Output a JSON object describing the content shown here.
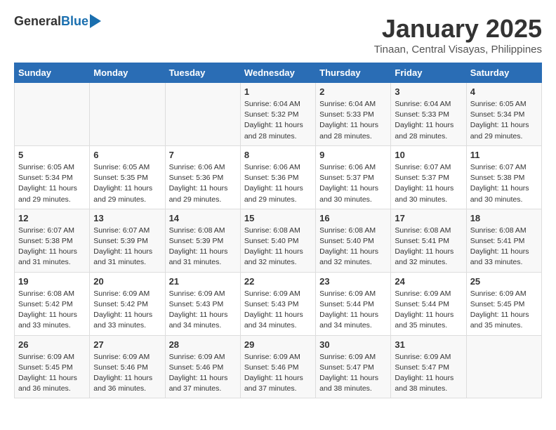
{
  "header": {
    "logo_general": "General",
    "logo_blue": "Blue",
    "month_title": "January 2025",
    "location": "Tinaan, Central Visayas, Philippines"
  },
  "days_of_week": [
    "Sunday",
    "Monday",
    "Tuesday",
    "Wednesday",
    "Thursday",
    "Friday",
    "Saturday"
  ],
  "weeks": [
    [
      {
        "day": "",
        "info": ""
      },
      {
        "day": "",
        "info": ""
      },
      {
        "day": "",
        "info": ""
      },
      {
        "day": "1",
        "info": "Sunrise: 6:04 AM\nSunset: 5:32 PM\nDaylight: 11 hours\nand 28 minutes."
      },
      {
        "day": "2",
        "info": "Sunrise: 6:04 AM\nSunset: 5:33 PM\nDaylight: 11 hours\nand 28 minutes."
      },
      {
        "day": "3",
        "info": "Sunrise: 6:04 AM\nSunset: 5:33 PM\nDaylight: 11 hours\nand 28 minutes."
      },
      {
        "day": "4",
        "info": "Sunrise: 6:05 AM\nSunset: 5:34 PM\nDaylight: 11 hours\nand 29 minutes."
      }
    ],
    [
      {
        "day": "5",
        "info": "Sunrise: 6:05 AM\nSunset: 5:34 PM\nDaylight: 11 hours\nand 29 minutes."
      },
      {
        "day": "6",
        "info": "Sunrise: 6:05 AM\nSunset: 5:35 PM\nDaylight: 11 hours\nand 29 minutes."
      },
      {
        "day": "7",
        "info": "Sunrise: 6:06 AM\nSunset: 5:36 PM\nDaylight: 11 hours\nand 29 minutes."
      },
      {
        "day": "8",
        "info": "Sunrise: 6:06 AM\nSunset: 5:36 PM\nDaylight: 11 hours\nand 29 minutes."
      },
      {
        "day": "9",
        "info": "Sunrise: 6:06 AM\nSunset: 5:37 PM\nDaylight: 11 hours\nand 30 minutes."
      },
      {
        "day": "10",
        "info": "Sunrise: 6:07 AM\nSunset: 5:37 PM\nDaylight: 11 hours\nand 30 minutes."
      },
      {
        "day": "11",
        "info": "Sunrise: 6:07 AM\nSunset: 5:38 PM\nDaylight: 11 hours\nand 30 minutes."
      }
    ],
    [
      {
        "day": "12",
        "info": "Sunrise: 6:07 AM\nSunset: 5:38 PM\nDaylight: 11 hours\nand 31 minutes."
      },
      {
        "day": "13",
        "info": "Sunrise: 6:07 AM\nSunset: 5:39 PM\nDaylight: 11 hours\nand 31 minutes."
      },
      {
        "day": "14",
        "info": "Sunrise: 6:08 AM\nSunset: 5:39 PM\nDaylight: 11 hours\nand 31 minutes."
      },
      {
        "day": "15",
        "info": "Sunrise: 6:08 AM\nSunset: 5:40 PM\nDaylight: 11 hours\nand 32 minutes."
      },
      {
        "day": "16",
        "info": "Sunrise: 6:08 AM\nSunset: 5:40 PM\nDaylight: 11 hours\nand 32 minutes."
      },
      {
        "day": "17",
        "info": "Sunrise: 6:08 AM\nSunset: 5:41 PM\nDaylight: 11 hours\nand 32 minutes."
      },
      {
        "day": "18",
        "info": "Sunrise: 6:08 AM\nSunset: 5:41 PM\nDaylight: 11 hours\nand 33 minutes."
      }
    ],
    [
      {
        "day": "19",
        "info": "Sunrise: 6:08 AM\nSunset: 5:42 PM\nDaylight: 11 hours\nand 33 minutes."
      },
      {
        "day": "20",
        "info": "Sunrise: 6:09 AM\nSunset: 5:42 PM\nDaylight: 11 hours\nand 33 minutes."
      },
      {
        "day": "21",
        "info": "Sunrise: 6:09 AM\nSunset: 5:43 PM\nDaylight: 11 hours\nand 34 minutes."
      },
      {
        "day": "22",
        "info": "Sunrise: 6:09 AM\nSunset: 5:43 PM\nDaylight: 11 hours\nand 34 minutes."
      },
      {
        "day": "23",
        "info": "Sunrise: 6:09 AM\nSunset: 5:44 PM\nDaylight: 11 hours\nand 34 minutes."
      },
      {
        "day": "24",
        "info": "Sunrise: 6:09 AM\nSunset: 5:44 PM\nDaylight: 11 hours\nand 35 minutes."
      },
      {
        "day": "25",
        "info": "Sunrise: 6:09 AM\nSunset: 5:45 PM\nDaylight: 11 hours\nand 35 minutes."
      }
    ],
    [
      {
        "day": "26",
        "info": "Sunrise: 6:09 AM\nSunset: 5:45 PM\nDaylight: 11 hours\nand 36 minutes."
      },
      {
        "day": "27",
        "info": "Sunrise: 6:09 AM\nSunset: 5:46 PM\nDaylight: 11 hours\nand 36 minutes."
      },
      {
        "day": "28",
        "info": "Sunrise: 6:09 AM\nSunset: 5:46 PM\nDaylight: 11 hours\nand 37 minutes."
      },
      {
        "day": "29",
        "info": "Sunrise: 6:09 AM\nSunset: 5:46 PM\nDaylight: 11 hours\nand 37 minutes."
      },
      {
        "day": "30",
        "info": "Sunrise: 6:09 AM\nSunset: 5:47 PM\nDaylight: 11 hours\nand 38 minutes."
      },
      {
        "day": "31",
        "info": "Sunrise: 6:09 AM\nSunset: 5:47 PM\nDaylight: 11 hours\nand 38 minutes."
      },
      {
        "day": "",
        "info": ""
      }
    ]
  ]
}
